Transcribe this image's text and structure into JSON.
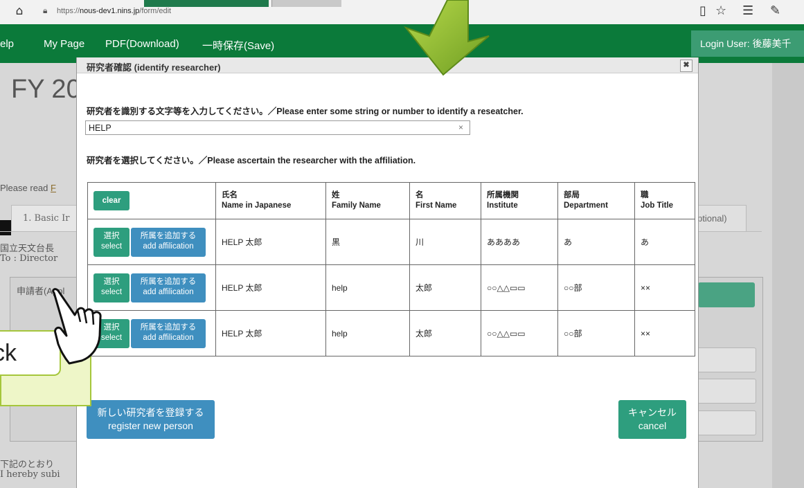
{
  "browser": {
    "url_prefix": "https://",
    "url_host": "nous-dev1.nins.jp",
    "url_path": "/form/edit"
  },
  "navbar": {
    "items": [
      "elp",
      "My Page",
      "PDF(Download)",
      "一時保存(Save)"
    ],
    "login_user": "Login User: 後藤美千"
  },
  "background": {
    "title": "FY 20",
    "read_prefix": "Please read ",
    "read_link": "F",
    "tab_basic": "1. Basic Ir",
    "tab_optional": "ptional)",
    "addr_jp": "国立天文台長",
    "addr_en": "To : Director",
    "panel_label": "申請者(Appl",
    "footer_jp": "下記のとおり",
    "footer_en": "I hereby subi"
  },
  "modal": {
    "title": "研究者確認 (identify researcher)",
    "prompt_enter": "研究者を識別する文字等を入力してください。／Please enter some string or number to identify a reseatcher.",
    "search_value": "HELP",
    "prompt_select": "研究者を選択してください。／Please ascertain the researcher with the affiliation.",
    "table": {
      "clear_label": "clear",
      "headers": [
        {
          "jp": "氏名",
          "en": "Name in Japanese"
        },
        {
          "jp": "姓",
          "en": "Family Name"
        },
        {
          "jp": "名",
          "en": "First Name"
        },
        {
          "jp": "所属機関",
          "en": "Institute"
        },
        {
          "jp": "部局",
          "en": "Department"
        },
        {
          "jp": "職",
          "en": "Job Title"
        }
      ],
      "select_label_jp": "選択",
      "select_label_en": "select",
      "add_label_jp": "所属を追加する",
      "add_label_en": "add affilication",
      "rows": [
        {
          "name": "HELP 太郎",
          "family": "黒",
          "first": "川",
          "institute": "ああああ",
          "department": "あ",
          "job": "あ"
        },
        {
          "name": "HELP 太郎",
          "family": "help",
          "first": "太郎",
          "institute": "○○△△▭▭",
          "department": "○○部",
          "job": "××"
        },
        {
          "name": "HELP 太郎",
          "family": "help",
          "first": "太郎",
          "institute": "○○△△▭▭",
          "department": "○○部",
          "job": "××"
        }
      ]
    },
    "register_jp": "新しい研究者を登録する",
    "register_en": "register new person",
    "cancel_jp": "キャンセル",
    "cancel_en": "cancel"
  },
  "annotation": {
    "click_text": "ck"
  }
}
